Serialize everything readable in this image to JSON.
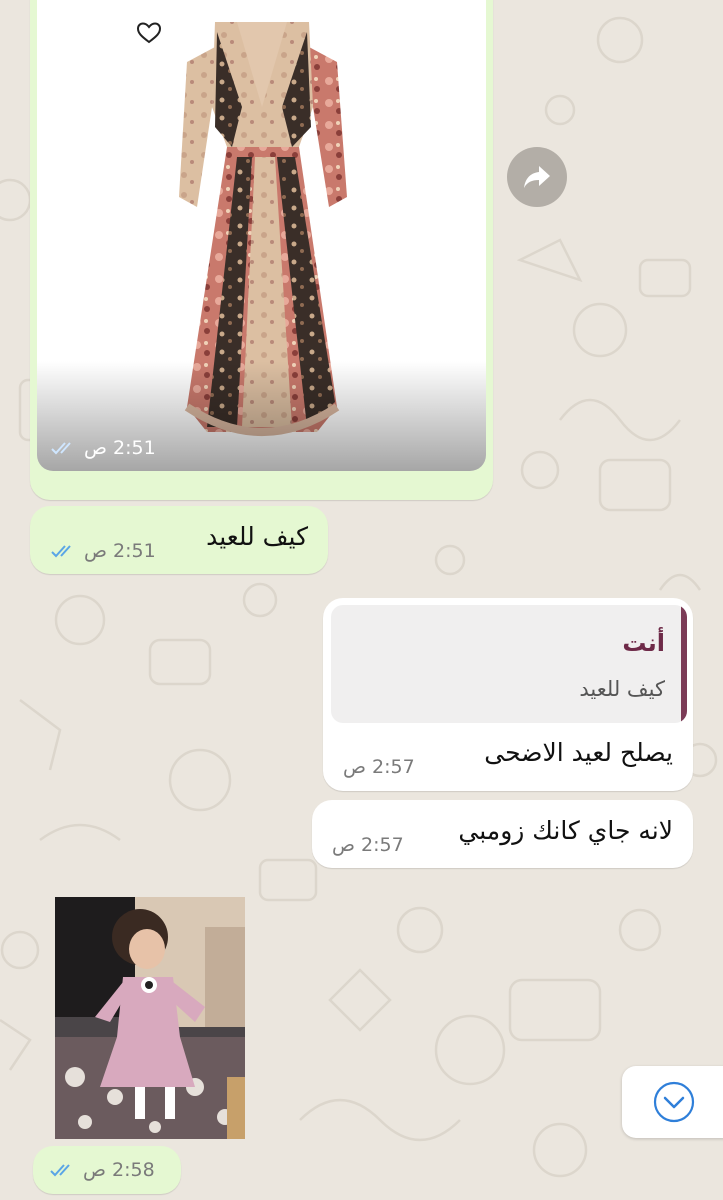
{
  "conversation": {
    "messages": [
      {
        "type": "image",
        "direction": "outgoing",
        "image_subject": "floral print long dress with ruffles",
        "favorite_icon": "heart-outline-icon",
        "time": "2:51",
        "period": "ص",
        "status_icon": "double-check-icon"
      },
      {
        "type": "text",
        "direction": "outgoing",
        "text": "كيف للعيد",
        "time": "2:51",
        "period": "ص",
        "status_icon": "double-check-icon"
      },
      {
        "type": "reply",
        "direction": "incoming",
        "quoted_author": "أنت",
        "quoted_text": "كيف للعيد",
        "text": "يصلح لعيد الاضحى",
        "time": "2:57",
        "period": "ص"
      },
      {
        "type": "text",
        "direction": "incoming",
        "text": "لانه جاي كانك زومبي",
        "time": "2:57",
        "period": "ص"
      },
      {
        "type": "sticker",
        "direction": "outgoing",
        "image_subject": "little girl in pink dress with hands on hips",
        "time": "2:58",
        "period": "ص",
        "status_icon": "double-check-icon"
      }
    ]
  },
  "actions": {
    "forward_icon": "forward-arrow-icon",
    "scroll_down_icon": "chevron-down-circle-icon"
  },
  "colors": {
    "wallpaper": "#ebe6de",
    "outgoing_bubble": "#e5f8d2",
    "incoming_bubble": "#ffffff",
    "read_checks": "#5aa5e6",
    "reply_accent": "#7b3b56",
    "scroll_icon": "#2f7fd9"
  }
}
